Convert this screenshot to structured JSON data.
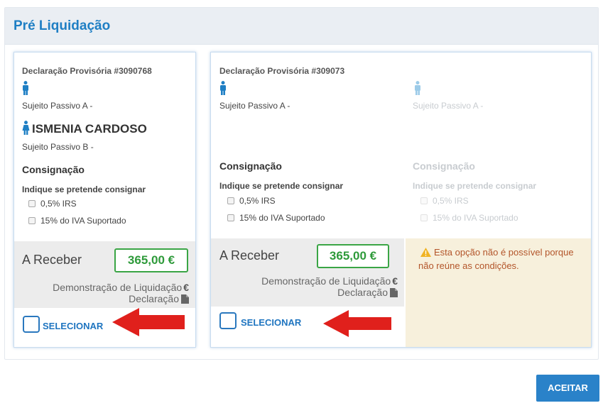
{
  "panel": {
    "title": "Pré Liquidação"
  },
  "card1": {
    "declaration_title": "Declaração Provisória #3090768",
    "sp_a_label": "Sujeito Passivo A -",
    "person_name": "ISMENIA CARDOSO",
    "sp_b_label": "Sujeito Passivo B -",
    "consignacao_title": "Consignação",
    "consignacao_prompt": "Indique se pretende consignar",
    "options": [
      "0,5% IRS",
      "15% do IVA Suportado"
    ],
    "receber_label": "A Receber",
    "amount": "365,00 €",
    "demo_link": "Demonstração de Liquidação",
    "euro_symbol": "€",
    "declaracao_link": "Declaração",
    "select_label": "SELECIONAR"
  },
  "card2": {
    "declaration_title": "Declaração Provisória #309073",
    "left": {
      "sp_a_label": "Sujeito Passivo A -",
      "consignacao_title": "Consignação",
      "consignacao_prompt": "Indique se pretende consignar",
      "options": [
        "0,5% IRS",
        "15% do IVA Suportado"
      ],
      "receber_label": "A Receber",
      "amount": "365,00 €",
      "demo_link": "Demonstração de Liquidação",
      "euro_symbol": "€",
      "declaracao_link": "Declaração",
      "select_label": "SELECIONAR"
    },
    "right": {
      "sp_a_label": "Sujeito Passivo A -",
      "consignacao_title": "Consignação",
      "consignacao_prompt": "Indique se pretende consignar",
      "options": [
        "0,5% IRS",
        "15% do IVA Suportado"
      ],
      "warning_text": "Esta opção não é possível porque não reúne as condições."
    }
  },
  "footer": {
    "accept_label": "ACEITAR"
  },
  "colors": {
    "accent": "#1f7fc4",
    "success": "#3aa545",
    "warning_bg": "#f7f0dc",
    "warning_text": "#b3552a",
    "arrow": "#e0201c"
  },
  "icons": [
    "person-icon",
    "person-female-icon",
    "checkbox-icon",
    "document-icon",
    "warning-icon",
    "red-arrow-icon"
  ]
}
